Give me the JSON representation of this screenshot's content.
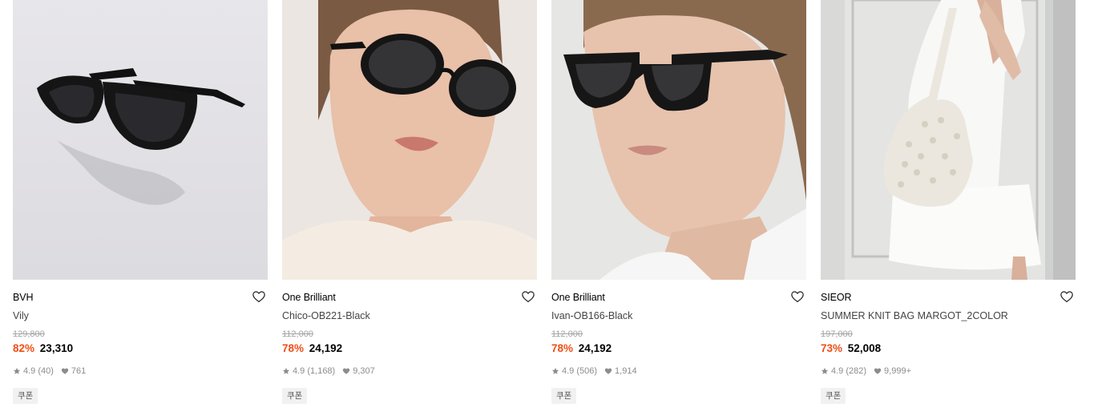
{
  "products": [
    {
      "brand": "BVH",
      "name": "Vily",
      "original_price": "129,800",
      "discount": "82%",
      "price": "23,310",
      "rating": "4.9",
      "review_count": "(40)",
      "likes": "761",
      "badge": "쿠폰",
      "image": "black cat-eye sunglasses on grey background"
    },
    {
      "brand": "One Brilliant",
      "name": "Chico-OB221-Black",
      "original_price": "112,000",
      "discount": "78%",
      "price": "24,192",
      "rating": "4.9",
      "review_count": "(1,168)",
      "likes": "9,307",
      "badge": "쿠폰",
      "image": "woman wearing oval black sunglasses"
    },
    {
      "brand": "One Brilliant",
      "name": "Ivan-OB166-Black",
      "original_price": "112,000",
      "discount": "78%",
      "price": "24,192",
      "rating": "4.9",
      "review_count": "(506)",
      "likes": "1,914",
      "badge": "쿠폰",
      "image": "woman wearing square black sunglasses"
    },
    {
      "brand": "SIEOR",
      "name": "SUMMER KNIT BAG MARGOT_2COLOR",
      "original_price": "197,000",
      "discount": "73%",
      "price": "52,008",
      "rating": "4.9",
      "review_count": "(282)",
      "likes": "9,999+",
      "badge": "쿠폰",
      "image": "woman in white dress carrying knit shoulder bag"
    }
  ],
  "colors": {
    "discount": "#f04e16",
    "muted": "#8c8c8c",
    "strike": "#a3a3a3",
    "badge_bg": "#f1f1f1"
  },
  "icons": {
    "wishlist": "heart-outline-icon",
    "rating": "star-icon",
    "likes": "heart-filled-icon"
  }
}
